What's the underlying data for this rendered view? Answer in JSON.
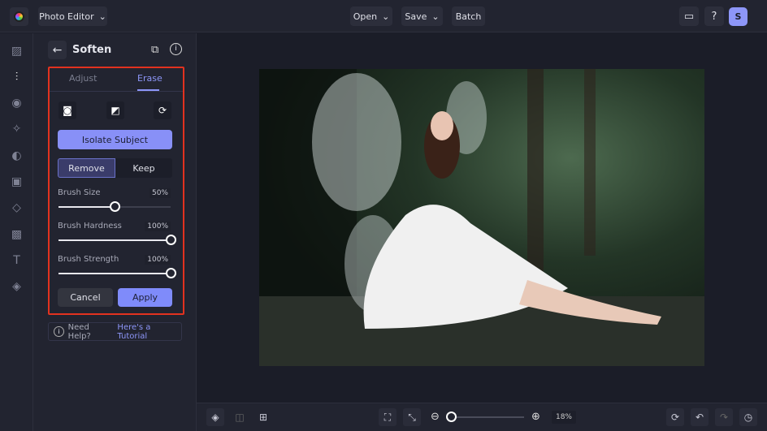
{
  "topbar": {
    "app_menu": "Photo Editor",
    "open": "Open",
    "save": "Save",
    "batch": "Batch",
    "avatar": "S"
  },
  "rail": {
    "items": [
      "image",
      "adjust",
      "eye",
      "effects",
      "palette",
      "frame",
      "shapes",
      "texture",
      "text",
      "overlay"
    ]
  },
  "panel": {
    "title": "Soften",
    "tabs": [
      "Adjust",
      "Erase"
    ],
    "active_tab": "Erase",
    "isolate": "Isolate Subject",
    "mode": [
      "Remove",
      "Keep"
    ],
    "active_mode": "Remove",
    "sliders": [
      {
        "label": "Brush Size",
        "value": "50%",
        "fraction": 0.5
      },
      {
        "label": "Brush Hardness",
        "value": "100%",
        "fraction": 1.0
      },
      {
        "label": "Brush Strength",
        "value": "100%",
        "fraction": 1.0
      }
    ],
    "cancel": "Cancel",
    "apply": "Apply",
    "help_text": "Need Help?",
    "help_link": "Here's a Tutorial"
  },
  "bottombar": {
    "zoom": "18%",
    "zoom_fraction": 0.0
  },
  "colors": {
    "accent": "#7f8bfa",
    "highlight": "#e2321f"
  }
}
